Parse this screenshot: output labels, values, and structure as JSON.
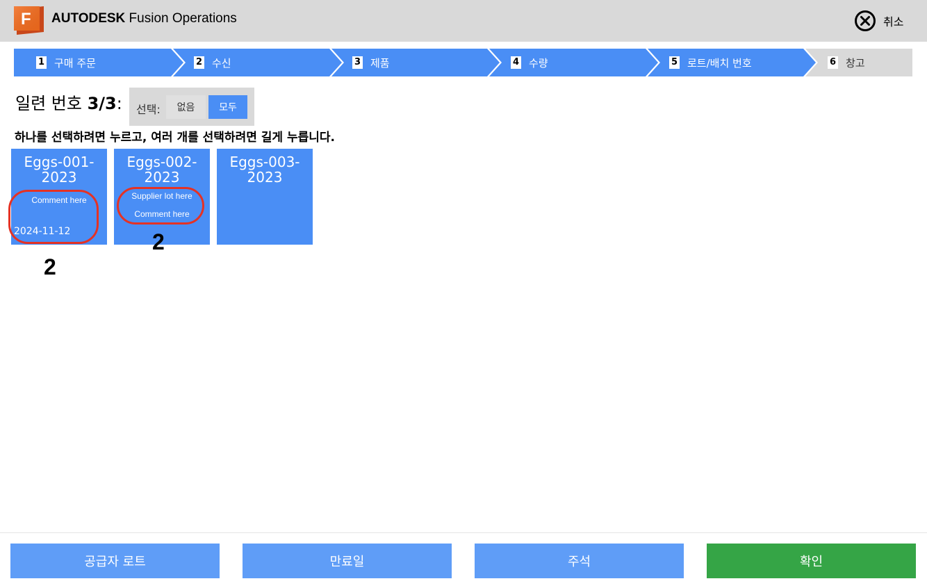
{
  "header": {
    "brand_bold": "AUTODESK",
    "brand_rest": " Fusion Operations",
    "logo_letter": "F",
    "cancel_label": "취소"
  },
  "steps": [
    {
      "num": "1",
      "label": "구매 주문"
    },
    {
      "num": "2",
      "label": "수신"
    },
    {
      "num": "3",
      "label": "제품"
    },
    {
      "num": "4",
      "label": "수량"
    },
    {
      "num": "5",
      "label": "로트/배치 번호"
    },
    {
      "num": "6",
      "label": "창고"
    }
  ],
  "serial": {
    "label": "일련 번호 ",
    "count": "3/3",
    "colon": ":"
  },
  "select": {
    "label": "선택:",
    "none": "없음",
    "all": "모두"
  },
  "hint": "하나를 선택하려면 누르고, 여러 개를 선택하려면 길게 누릅니다.",
  "cards": [
    {
      "title": "Eggs-001-2023",
      "line1": "Comment here",
      "date": "2024-11-12"
    },
    {
      "title": "Eggs-002-2023",
      "line1": "Supplier lot here",
      "line2": "Comment here"
    },
    {
      "title": "Eggs-003-2023"
    }
  ],
  "annotations": {
    "marker1": "2",
    "marker2": "2"
  },
  "footer": {
    "supplier_lot": "공급자 로트",
    "expiry": "만료일",
    "comment": "주석",
    "confirm": "확인"
  },
  "colors": {
    "accent_blue": "#4a8ef5",
    "confirm_green": "#35a546",
    "annotation_red": "#e53224",
    "logo_orange": "#f26b1d"
  }
}
